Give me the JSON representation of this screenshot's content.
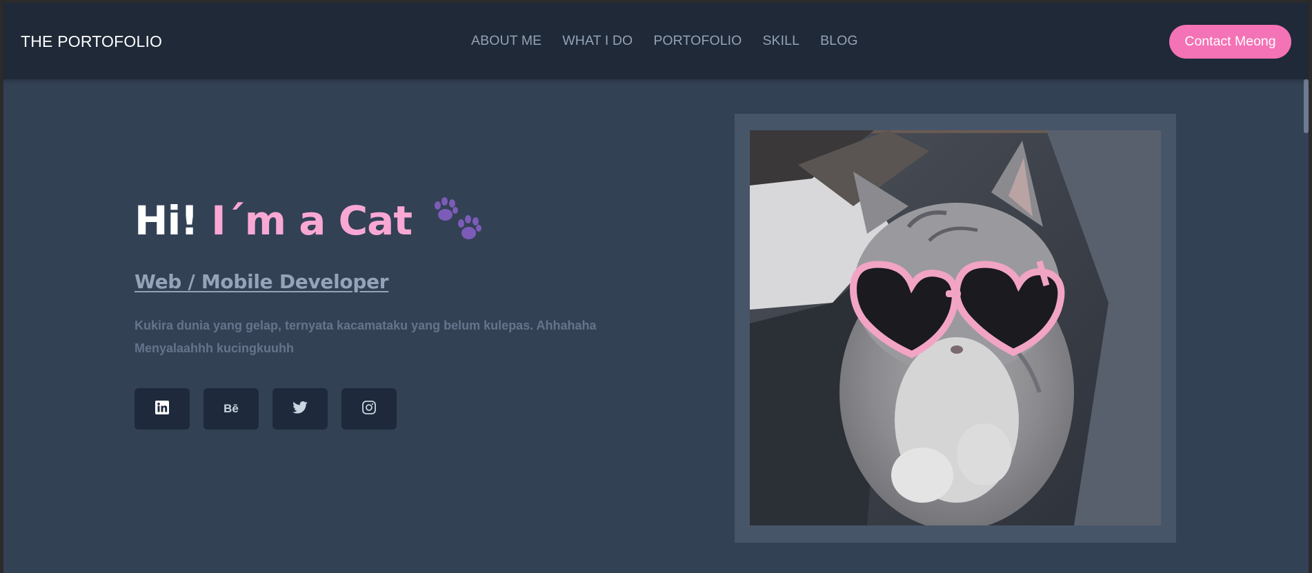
{
  "nav": {
    "brand": "THE PORTOFOLIO",
    "links": [
      "ABOUT ME",
      "WHAT I DO",
      "PORTOFOLIO",
      "SKILL",
      "BLOG"
    ],
    "contact_label": "Contact Meong"
  },
  "hero": {
    "title_white": "Hi!",
    "title_pink": "I´m a Cat",
    "subtitle": "Web / Mobile Developer",
    "description": "Kukira dunia yang gelap, ternyata kacamataku yang belum kulepas. Ahhahaha Menyalaahhh kucingkuuhh",
    "socials": [
      {
        "icon": "linkedin-icon"
      },
      {
        "icon": "behance-icon",
        "text": "Bē"
      },
      {
        "icon": "twitter-icon"
      },
      {
        "icon": "instagram-icon"
      }
    ]
  },
  "colors": {
    "navbar_bg": "#1f2937",
    "page_bg": "#334155",
    "accent_pink": "#f472b6",
    "title_pink": "#f9a8d4",
    "paw_purple": "#7c5cb8"
  }
}
